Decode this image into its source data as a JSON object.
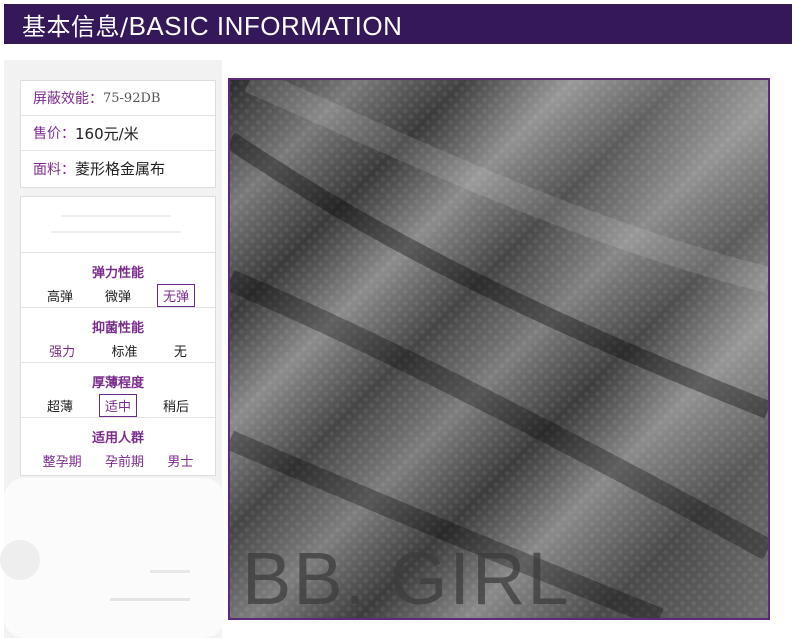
{
  "header": {
    "title_cn": "基本信息/",
    "title_en": "BASIC INFORMATION"
  },
  "info": {
    "shielding_label": "屏蔽效能：",
    "shielding_value": "75-92DB",
    "price_label": "售价：",
    "price_value": "160元/米",
    "material_label": "面料：",
    "material_value": "菱形格金属布"
  },
  "properties": [
    {
      "title": "弹力性能",
      "options": [
        "高弹",
        "微弹",
        "无弹"
      ],
      "selected": 2
    },
    {
      "title": "抑菌性能",
      "options": [
        "强力",
        "标准",
        "无"
      ],
      "selected": -1,
      "accent": 0
    },
    {
      "title": "厚薄程度",
      "options": [
        "超薄",
        "适中",
        "稍后"
      ],
      "selected": 1
    },
    {
      "title": "适用人群",
      "options": [
        "整孕期",
        "孕前期",
        "男士"
      ],
      "selected": -1,
      "accent_all": true
    }
  ],
  "photo": {
    "watermark": "BB. GIRL"
  },
  "colors": {
    "brand_purple": "#35185a",
    "accent_purple": "#7b2d8e"
  }
}
